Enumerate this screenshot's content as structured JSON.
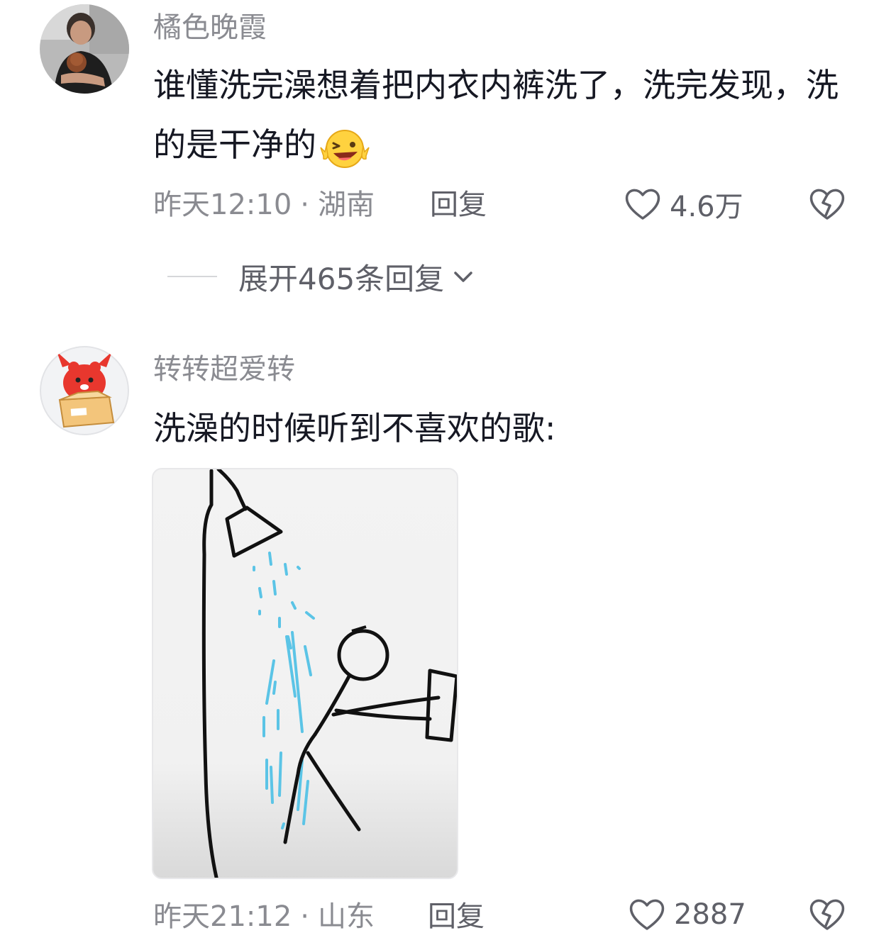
{
  "comments": [
    {
      "username": "橘色晚霞",
      "text": "谁懂洗完澡想着把内衣内裤洗了，洗完发现，洗的是干净的",
      "emoji_icon": "squinting-laughing-peace-emoji",
      "time": "昨天12:10",
      "separator": "·",
      "location": "湖南",
      "reply_label": "回复",
      "likes": "4.6万",
      "expand_label": "展开465条回复"
    },
    {
      "username": "转转超爱转",
      "text": "洗澡的时候听到不喜欢的歌:",
      "attachment_icon": "stick-figure-shower-drawing",
      "time": "昨天21:12",
      "separator": "·",
      "location": "山东",
      "reply_label": "回复",
      "likes": "2887"
    }
  ],
  "icons": {
    "like": "heart-outline-icon",
    "dislike": "broken-heart-icon",
    "expand": "chevron-down-icon"
  },
  "colors": {
    "text_primary": "#161823",
    "text_secondary": "#8a8b91",
    "water": "#5bc4e6",
    "avatar2_red": "#e8372e"
  }
}
